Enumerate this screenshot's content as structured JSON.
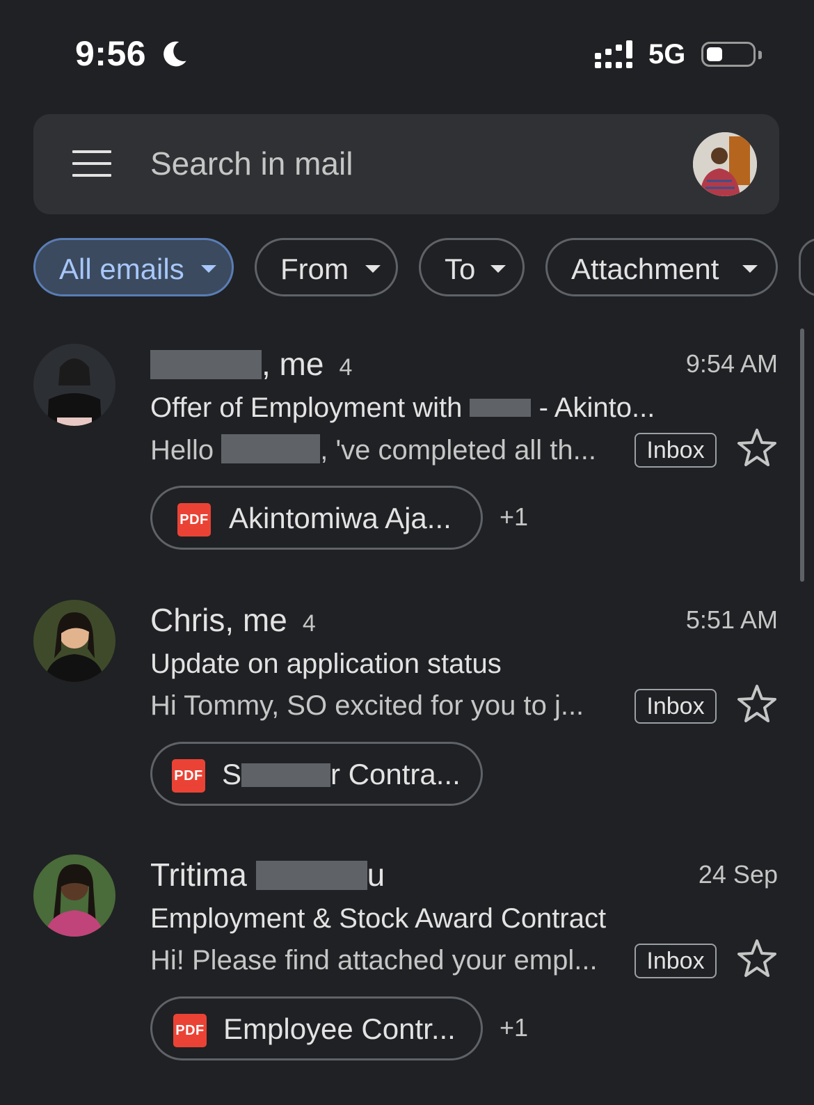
{
  "status_bar": {
    "time": "9:56",
    "network": "5G"
  },
  "search": {
    "placeholder": "Search in mail"
  },
  "chips": [
    {
      "label": "All emails",
      "selected": true
    },
    {
      "label": "From"
    },
    {
      "label": "To"
    },
    {
      "label": "Attachment"
    }
  ],
  "emails": [
    {
      "sender_suffix": ", me",
      "count": "4",
      "time": "9:54 AM",
      "subject_start": "Offer of Employment with",
      "subject_end": "- Akinto...",
      "snippet_start": "Hello",
      "snippet_end": ", 've completed all th...",
      "label": "Inbox",
      "attachment": "Akintomiwa Aja...",
      "more": "+1"
    },
    {
      "sender": "Chris, me",
      "count": "4",
      "time": "5:51 AM",
      "subject": "Update on application status",
      "snippet": "Hi Tommy, SO excited for you to j...",
      "label": "Inbox",
      "attachment_start": "S",
      "attachment_end": "r Contra..."
    },
    {
      "sender_start": "Tritima",
      "sender_end": "u",
      "time": "24 Sep",
      "subject": "Employment & Stock Award Contract",
      "snippet": "Hi! Please find attached your empl...",
      "label": "Inbox",
      "attachment": "Employee Contr...",
      "more": "+1"
    }
  ],
  "pdf_badge": "PDF",
  "colors": {
    "background": "#202124",
    "surface": "#303134",
    "accent": "#a8c7fa",
    "pdf": "#ea4335"
  }
}
